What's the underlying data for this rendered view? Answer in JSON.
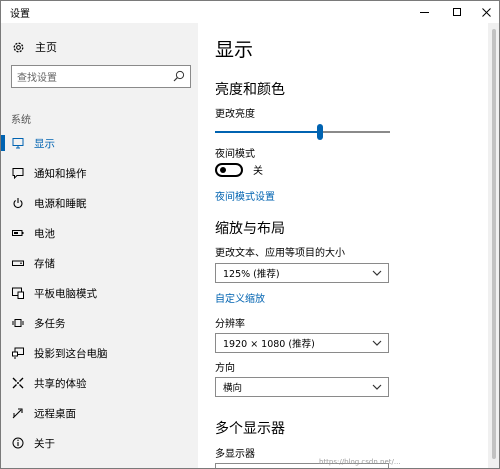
{
  "window": {
    "title": "设置",
    "minimize_icon": "minimize-icon",
    "maximize_icon": "maximize-icon",
    "close_icon": "close-icon"
  },
  "sidebar": {
    "home_label": "主页",
    "search_placeholder": "查找设置",
    "section_label": "系统",
    "items": [
      {
        "label": "显示",
        "icon": "monitor-icon",
        "active": true
      },
      {
        "label": "通知和操作",
        "icon": "notification-icon"
      },
      {
        "label": "电源和睡眠",
        "icon": "power-icon"
      },
      {
        "label": "电池",
        "icon": "battery-icon"
      },
      {
        "label": "存储",
        "icon": "storage-icon"
      },
      {
        "label": "平板电脑模式",
        "icon": "tablet-mode-icon"
      },
      {
        "label": "多任务",
        "icon": "multitasking-icon"
      },
      {
        "label": "投影到这台电脑",
        "icon": "project-icon"
      },
      {
        "label": "共享的体验",
        "icon": "shared-experiences-icon"
      },
      {
        "label": "远程桌面",
        "icon": "remote-desktop-icon"
      },
      {
        "label": "关于",
        "icon": "info-icon"
      }
    ]
  },
  "main": {
    "title": "显示",
    "brightness_section": "亮度和颜色",
    "brightness_label": "更改亮度",
    "brightness_level": 0.6,
    "night_light_label": "夜间模式",
    "night_light_state": "关",
    "night_light_settings_link": "夜间模式设置",
    "scale_section": "缩放与布局",
    "scale_label": "更改文本、应用等项目的大小",
    "scale_value": "125% (推荐)",
    "custom_scaling_link": "自定义缩放",
    "resolution_label": "分辨率",
    "resolution_value": "1920 × 1080 (推荐)",
    "orientation_label": "方向",
    "orientation_value": "横向",
    "multi_display_section": "多个显示器",
    "multi_display_label": "多显示器"
  },
  "watermark": "https://blog.csdn.net/..."
}
